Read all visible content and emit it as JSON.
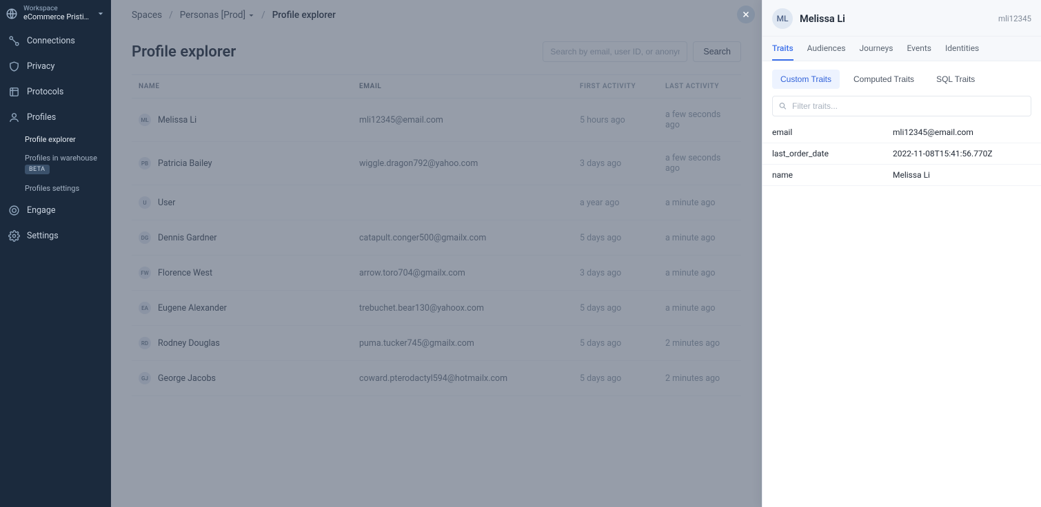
{
  "workspace": {
    "label": "Workspace",
    "name": "eCommerce Pristi…"
  },
  "sidebar": {
    "items": [
      {
        "label": "Connections"
      },
      {
        "label": "Privacy"
      },
      {
        "label": "Protocols"
      },
      {
        "label": "Profiles"
      },
      {
        "label": "Engage"
      },
      {
        "label": "Settings"
      }
    ],
    "subitems": [
      {
        "label": "Profile explorer"
      },
      {
        "label": "Profiles in warehouse",
        "badge": "BETA"
      },
      {
        "label": "Profiles settings"
      }
    ]
  },
  "breadcrumb": {
    "root": "Spaces",
    "space": "Personas [Prod]",
    "current": "Profile explorer"
  },
  "page": {
    "title": "Profile explorer",
    "search_placeholder": "Search by email, user ID, or anonymous ID...",
    "search_button": "Search"
  },
  "table": {
    "headers": {
      "name": "NAME",
      "email": "EMAIL",
      "first": "FIRST ACTIVITY",
      "last": "LAST ACTIVITY"
    },
    "rows": [
      {
        "initials": "ML",
        "name": "Melissa Li",
        "email": "mli12345@email.com",
        "first": "5 hours ago",
        "last": "a few seconds ago"
      },
      {
        "initials": "PB",
        "name": "Patricia Bailey",
        "email": "wiggle.dragon792@yahoo.com",
        "first": "3 days ago",
        "last": "a few seconds ago"
      },
      {
        "initials": "U",
        "name": "User",
        "email": "",
        "first": "a year ago",
        "last": "a minute ago"
      },
      {
        "initials": "DG",
        "name": "Dennis Gardner",
        "email": "catapult.conger500@gmailx.com",
        "first": "5 days ago",
        "last": "a minute ago"
      },
      {
        "initials": "FW",
        "name": "Florence West",
        "email": "arrow.toro704@gmailx.com",
        "first": "3 days ago",
        "last": "a minute ago"
      },
      {
        "initials": "EA",
        "name": "Eugene Alexander",
        "email": "trebuchet.bear130@yahoox.com",
        "first": "5 days ago",
        "last": "a minute ago"
      },
      {
        "initials": "RD",
        "name": "Rodney Douglas",
        "email": "puma.tucker745@gmailx.com",
        "first": "5 days ago",
        "last": "2 minutes ago"
      },
      {
        "initials": "GJ",
        "name": "George Jacobs",
        "email": "coward.pterodactyl594@hotmailx.com",
        "first": "5 days ago",
        "last": "2 minutes ago"
      }
    ]
  },
  "panel": {
    "avatar_initials": "ML",
    "name": "Melissa Li",
    "id": "mli12345",
    "tabs": [
      "Traits",
      "Audiences",
      "Journeys",
      "Events",
      "Identities"
    ],
    "active_tab": "Traits",
    "subtabs": [
      "Custom Traits",
      "Computed Traits",
      "SQL Traits"
    ],
    "active_subtab": "Custom Traits",
    "filter_placeholder": "Filter traits...",
    "traits": [
      {
        "key": "email",
        "value": "mli12345@email.com"
      },
      {
        "key": "last_order_date",
        "value": "2022-11-08T15:41:56.770Z"
      },
      {
        "key": "name",
        "value": "Melissa Li"
      }
    ]
  }
}
